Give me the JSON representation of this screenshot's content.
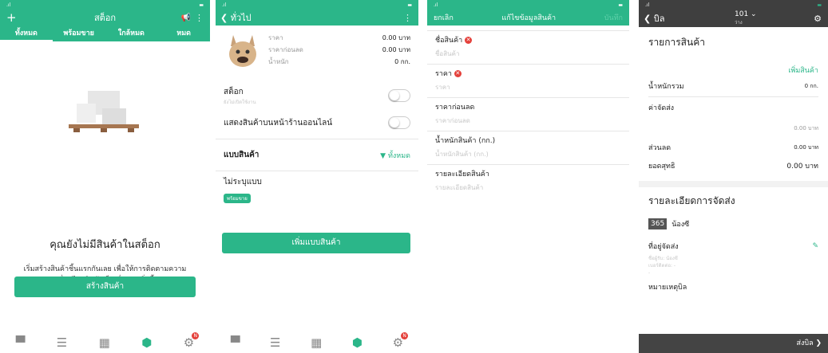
{
  "screen1": {
    "plus_icon": "+",
    "title": "สต็อก",
    "tabs": [
      "ทั้งหมด",
      "พร้อมขาย",
      "ใกล้หมด",
      "หมด"
    ],
    "empty_title": "คุณยังไม่มีสินค้าในสต็อก",
    "empty_desc": "เริ่มสร้างสินค้าชิ้นแรกกันเลย เพื่อให้การติดตามความเคลื่อนไหวสินค้าเป็นเรื่องง่ายยิ่งขึ้น",
    "create_button": "สร้างสินค้า",
    "badge": "N"
  },
  "screen2": {
    "back_label": "ทั่วไป",
    "fields": [
      {
        "label": "ราคา",
        "value": "0.00 บาท"
      },
      {
        "label": "ราคาก่อนลด",
        "value": "0.00 บาท"
      },
      {
        "label": "น้ำหนัก",
        "value": "0 กก."
      }
    ],
    "stock_label": "สต็อก",
    "stock_sub": "ยังไม่เปิดใช้งาน",
    "online_label": "แสดงสินค้าบนหน้าร้านออนไลน์",
    "variant_title": "แบบสินค้า",
    "filter_label": "ทั้งหมด",
    "variant_name": "ไม่ระบุแบบ",
    "variant_tag": "พร้อมขาย",
    "add_variant_button": "เพิ่มแบบสินค้า",
    "badge": "N"
  },
  "screen3": {
    "cancel": "ยกเลิก",
    "title": "แก้ไขข้อมูลสินค้า",
    "save": "บันทึก",
    "fields": [
      {
        "label": "ชื่อสินค้า",
        "placeholder": "ชื่อสินค้า"
      },
      {
        "label": "ราคา",
        "placeholder": "ราคา"
      },
      {
        "label": "ราคาก่อนลด",
        "placeholder": "ราคาก่อนลด"
      },
      {
        "label": "น้ำหนักสินค้า (กก.)",
        "placeholder": "น้ำหนักสินค้า (กก.)"
      },
      {
        "label": "รายละเอียดสินค้า",
        "placeholder": "รายละเอียดสินค้า"
      }
    ]
  },
  "screen4": {
    "back_label": "บิล",
    "bill_no": "101",
    "bill_sub": "ว่าง",
    "items_title": "รายการสินค้า",
    "add_item": "เพิ่มสินค้า",
    "weight_label": "น้ำหนักรวม",
    "weight_value": "0 กก.",
    "shipping_label": "ค่าจัดส่ง",
    "shipping_value": "0.00 บาท",
    "discount_label": "ส่วนลด",
    "discount_value": "0.00 บาท",
    "net_label": "ยอดสุทธิ",
    "net_value": "0.00 บาท",
    "delivery_title": "รายละเอียดการจัดส่ง",
    "carrier_logo": "365",
    "carrier_name": "น้องซี",
    "address_label": "ที่อยู่จัดส่ง",
    "address_line1": "ชื่อผู้รับ: น้องซี",
    "address_line2": "เบอร์ติดต่อ: -",
    "address_line3": "-",
    "note_label": "หมายเหตุบิล",
    "send_bill": "ส่งบิล"
  },
  "colors": {
    "accent": "#2bb689",
    "error": "#e4403a"
  }
}
